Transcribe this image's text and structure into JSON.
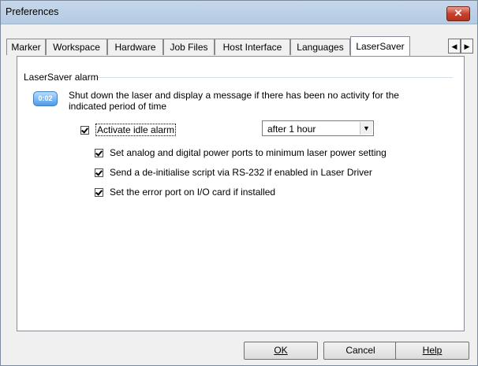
{
  "window": {
    "title": "Preferences",
    "close_icon": "close-icon"
  },
  "tabs": [
    {
      "label": "Marker"
    },
    {
      "label": "Workspace"
    },
    {
      "label": "Hardware"
    },
    {
      "label": "Job Files"
    },
    {
      "label": "Host Interface"
    },
    {
      "label": "Languages"
    },
    {
      "label": "LaserSaver",
      "active": true
    }
  ],
  "tab_scroll": {
    "left": "◀",
    "right": "▶"
  },
  "group": {
    "label": "LaserSaver alarm",
    "badge": "0:02",
    "description": "Shut down the laser and display a message if there has been no activity for the indicated period of time"
  },
  "activate": {
    "label": "Activate idle alarm",
    "checked": true
  },
  "idle_select": {
    "value": "after 1 hour"
  },
  "options": [
    {
      "label": "Set analog and digital power ports to minimum laser power setting",
      "checked": true
    },
    {
      "label": "Send a de-initialise script via RS-232 if enabled in Laser Driver",
      "checked": true
    },
    {
      "label": "Set the error port on I/O card if installed",
      "checked": true
    }
  ],
  "buttons": {
    "ok": "OK",
    "cancel": "Cancel",
    "help": "Help"
  },
  "colors": {
    "title_bar": "#b9cfe6",
    "close": "#c8412d",
    "badge": "#4b9be8"
  }
}
